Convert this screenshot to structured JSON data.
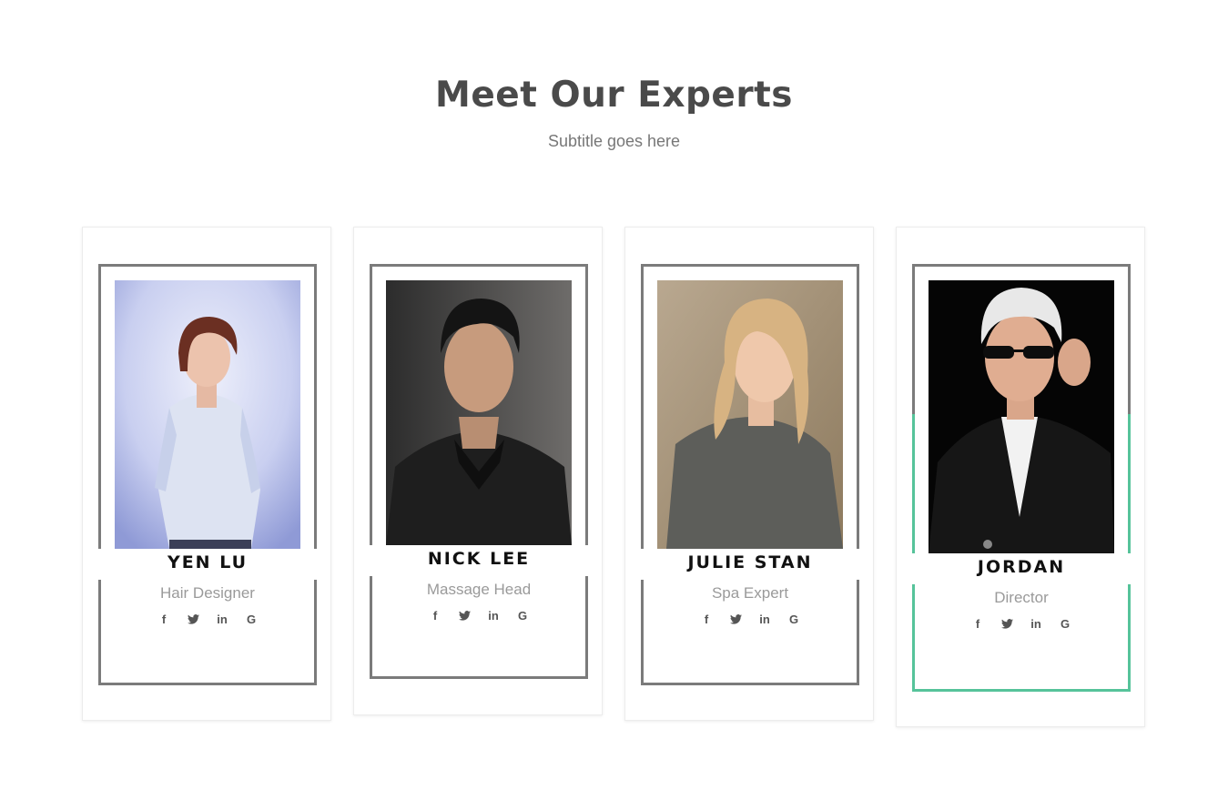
{
  "section": {
    "title": "Meet Our Experts",
    "subtitle": "Subtitle goes here"
  },
  "experts": [
    {
      "name": "YEN LU",
      "role": "Hair Designer"
    },
    {
      "name": "NICK LEE",
      "role": "Massage Head"
    },
    {
      "name": "JULIE STAN",
      "role": "Spa Expert"
    },
    {
      "name": "JORDAN",
      "role": "Director"
    }
  ],
  "social_icons": [
    {
      "icon": "facebook-icon",
      "glyph": "f"
    },
    {
      "icon": "twitter-icon",
      "glyph": "🐦"
    },
    {
      "icon": "linkedin-icon",
      "glyph": "in"
    },
    {
      "icon": "google-icon",
      "glyph": "G"
    }
  ],
  "colors": {
    "heading": "#4a4a4a",
    "frame": "#7b7b7b",
    "accent": "#56c39a"
  }
}
